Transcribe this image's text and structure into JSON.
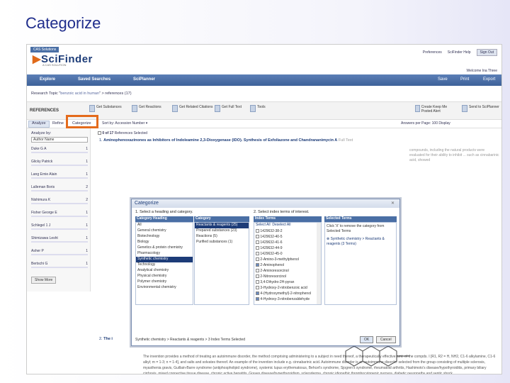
{
  "slide_title": "Categorize",
  "app": {
    "tag": "CAS Solutions",
    "logo": "SciFinder",
    "logo_sub": "A CAS SOLUTION",
    "top_links": [
      "Preferences",
      "SciFinder Help"
    ],
    "sign_out": "Sign Out",
    "welcome": "Welcome Ina Three",
    "nav": [
      "Explore",
      "Saved Searches",
      "SciPlanner"
    ],
    "nav_right": [
      "Save",
      "Print",
      "Export"
    ]
  },
  "breadcrumb": {
    "prefix": "Research Topic \"",
    "topic": "benzoic acid in human",
    "suffix": "\" > references (17)"
  },
  "toolbar": {
    "refs_label": "REFERENCES",
    "tools": [
      "Get Substances",
      "Get Reactions",
      "Get Related Citations",
      "Get Full Text",
      "Tools"
    ],
    "right_tools": [
      "Create Keep Me Posted Alert",
      "Send to SciPlanner"
    ]
  },
  "tabs": [
    "Analyze",
    "Refine",
    "Categorize"
  ],
  "sort": {
    "label": "Sort by:",
    "value": "Accession Number"
  },
  "selection": {
    "count": "0 of 17",
    "text": "References Selected"
  },
  "answers": "Answers per Page: 100   Display",
  "left_panel": {
    "title": "Analyze by:",
    "select": "Author Name",
    "items": [
      {
        "name": "Duke G A",
        "count": "1"
      },
      {
        "name": "Glicky Patrick",
        "count": "1"
      },
      {
        "name": "Lang Ernie Alain",
        "count": "1"
      },
      {
        "name": "Lalleman Boris",
        "count": "2"
      },
      {
        "name": "Nishimura K",
        "count": "2"
      },
      {
        "name": "Fisher George E",
        "count": "1"
      },
      {
        "name": "Schlegel 1 J",
        "count": "1"
      },
      {
        "name": "Shimizawa Lesht",
        "count": "1"
      },
      {
        "name": "Asher P",
        "count": "1"
      },
      {
        "name": "Bertschi G",
        "count": "1"
      }
    ],
    "show_more": "Show More"
  },
  "results": [
    {
      "num": "1.",
      "title": "Aminophenoxazinones as Inhibitors of Indoleamine 2,3-Dioxygenase (IDO). Synthesis of Exfoliazone and Chandrananimycin A",
      "full_text": "Full Text"
    },
    {
      "num": "2.",
      "title": "The i",
      "full_text": ""
    }
  ],
  "result_snippet_1": "compounds, including the natural products were evaluated for their ability to inhibit ... such as cinnabarinic acid, showed",
  "result_body_2": "The invention provides a method of treating an autoimmune disorder, the method comprising administering to a subject in need thereof, a therapeutically effective amt. of the compds. I [R1, R2 = H, NH2, C1-6 alkylamine, C1-6 alkyl; m = 1-3; n = 1-4], and salts and solvates thereof. An example of the invention include e.g. cinnabarinic acid. Autoimmune disorder is an autoimmune disorder selected from the group consisting of multiple sclerosis, myasthenia gravis, Guillain-Barre syndrome (antiphospholipid syndrome), systemic lupus erythematosus, Behcet's syndrome, Sjogren's syndrome, rheumatoid arthritis, Hashimoto's disease/hypothyroiditis, primary biliary cirrhosis, mixed connective tissue disease, chronic active hepatitis, Graves disease/hyperthyroidism, scleroderma, chronic idiopathic thrombocytopenic purpura, diabetic neuropathy and septic shock.",
  "modal": {
    "title": "Categorize",
    "step1": "1. Select a heading and category.",
    "step2": "2. Select index terms of interest.",
    "headers": [
      "Category Heading",
      "Category",
      "Index Terms",
      "Selected Terms"
    ],
    "headings": [
      "All",
      "General chemistry",
      "Biotechnology",
      "Biology",
      "Genetics & protein chemistry",
      "Pharmacology",
      "Synthetic chemistry",
      "Technology",
      "Analytical chemistry",
      "Physical chemistry",
      "Polymer chemistry",
      "Environmental chemistry"
    ],
    "categories": [
      "Reactants & reagents (25)",
      "Prepared substances (23)",
      "Reactions (5)",
      "Purified substances (1)"
    ],
    "select_all": "Select All",
    "deselect_all": "Deselect All",
    "terms": [
      {
        "label": "1429632-38-2",
        "count": "1",
        "checked": false
      },
      {
        "label": "1429632-40-5",
        "count": "1",
        "checked": false
      },
      {
        "label": "1429632-41-6",
        "count": "1",
        "checked": false
      },
      {
        "label": "1429632-44-9",
        "count": "1",
        "checked": false
      },
      {
        "label": "1429632-45-0",
        "count": "1",
        "checked": false
      },
      {
        "label": "2-Amino-3-methylphenol",
        "count": "1",
        "checked": false
      },
      {
        "label": "2-Aminophenol",
        "count": "1",
        "checked": true
      },
      {
        "label": "2-Aminoresorcinol",
        "count": "1",
        "checked": false
      },
      {
        "label": "2-Nitroresorcinol",
        "count": "1",
        "checked": false
      },
      {
        "label": "3,4-Dihydro-2H-pyran",
        "count": "1",
        "checked": false
      },
      {
        "label": "3-Hydroxy-2-nitrobenzoic acid",
        "count": "1",
        "checked": false
      },
      {
        "label": "4-(Hydroxymethyl)-2-nitrophenol",
        "count": "1",
        "checked": true
      },
      {
        "label": "4-Hydroxy-3-nitrobenzaldehyde",
        "count": "1",
        "checked": true
      }
    ],
    "selected_help": "Click 'X' to remove the category from Selected Terms",
    "selected_item": "Synthetic chemistry > Reactants & reagents (3 Terms)",
    "status": "Synthetic chemistry > Reactants & reagents > 3 Index Terms Selected",
    "ok": "OK",
    "cancel": "Cancel"
  },
  "colors": {
    "brand": "#1d3c78",
    "nav": "#4a6fa5",
    "highlight": "#e46b1c",
    "selected_row": "#1d3c78"
  }
}
